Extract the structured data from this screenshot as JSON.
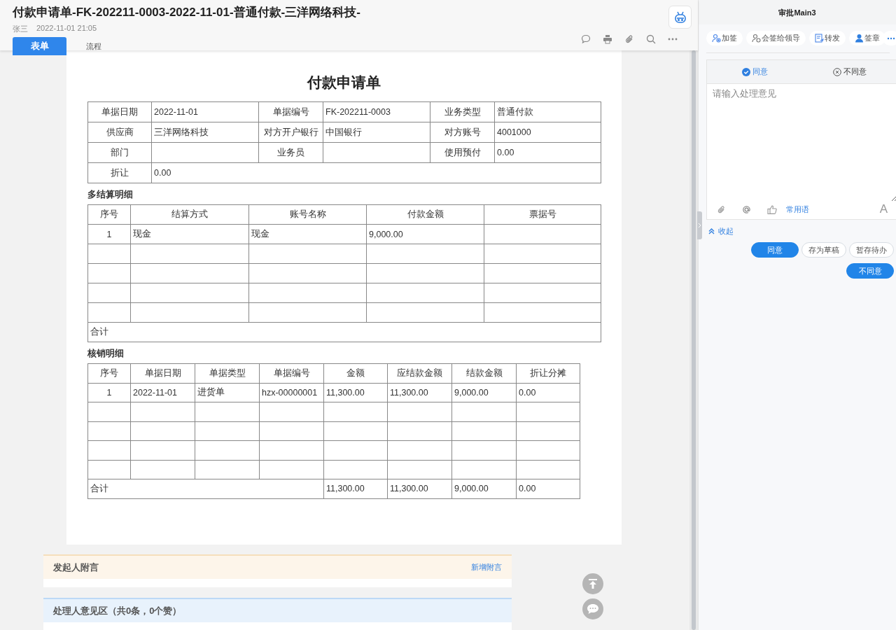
{
  "header": {
    "title": "付款申请单-FK-202211-0003-2022-11-01-普通付款-三洋网络科技-",
    "author": "张三",
    "time": "2022-11-01 21:05",
    "tabs": [
      {
        "label": "表单",
        "selected": true
      },
      {
        "label": "流程",
        "selected": false
      }
    ]
  },
  "form": {
    "title": "付款申请单",
    "fields": [
      [
        {
          "label": "单据日期",
          "value": "2022-11-01"
        },
        {
          "label": "单据编号",
          "value": "FK-202211-0003"
        },
        {
          "label": "业务类型",
          "value": "普通付款"
        }
      ],
      [
        {
          "label": "供应商",
          "value": "三洋网络科技"
        },
        {
          "label": "对方开户银行",
          "value": "中国银行"
        },
        {
          "label": "对方账号",
          "value": "4001000"
        }
      ],
      [
        {
          "label": "部门"
        },
        {
          "label": "业务员"
        },
        {
          "label": "使用预付",
          "value": "0.00"
        }
      ],
      [
        {
          "label": "折让",
          "value": "0.00"
        }
      ]
    ],
    "settlement": {
      "title": "多结算明细",
      "columns": [
        "序号",
        "结算方式",
        "账号名称",
        "付款金额",
        "票据号"
      ],
      "rows": [
        [
          "1",
          "现金",
          "现金",
          "9,000.00"
        ]
      ],
      "total_label": "合计"
    },
    "writeoff": {
      "title": "核销明细",
      "columns": [
        "序号",
        "单据日期",
        "单据类型",
        "单据编号",
        "金额",
        "应结款金额",
        "结款金额",
        "折让分摊"
      ],
      "rows": [
        [
          "1",
          "2022-11-01",
          "进货单",
          "hzx-00000001",
          "11,300.00",
          "11,300.00",
          "9,000.00",
          "0.00"
        ]
      ],
      "total": {
        "label": "合计",
        "values": [
          "11,300.00",
          "11,300.00",
          "9,000.00",
          "0.00"
        ]
      }
    }
  },
  "initiator_note": {
    "title": "发起人附言",
    "link": "新增附言"
  },
  "handler_opinions": {
    "title": "处理人意见区（共0条，0个赞）"
  },
  "approval_panel": {
    "title": "审批Main3",
    "actions": [
      {
        "label": "加签",
        "kind": "add-sign"
      },
      {
        "label": "会签给领导",
        "kind": "countersign"
      },
      {
        "label": "转发",
        "kind": "forward"
      },
      {
        "label": "签章",
        "kind": "seal"
      }
    ],
    "decision_tabs": [
      {
        "label": "同意",
        "selected": true
      },
      {
        "label": "不同意",
        "selected": false
      }
    ],
    "comment": {
      "placeholder": "请输入处理意见",
      "phrases_link": "常用语",
      "font_button": "A"
    },
    "collapse_link": "收起",
    "buttons": [
      {
        "label": "同意",
        "kind": "primary"
      },
      {
        "label": "存为草稿",
        "kind": "default"
      },
      {
        "label": "暂存待办",
        "kind": "default"
      },
      {
        "label": "不同意",
        "kind": "primary"
      }
    ]
  }
}
